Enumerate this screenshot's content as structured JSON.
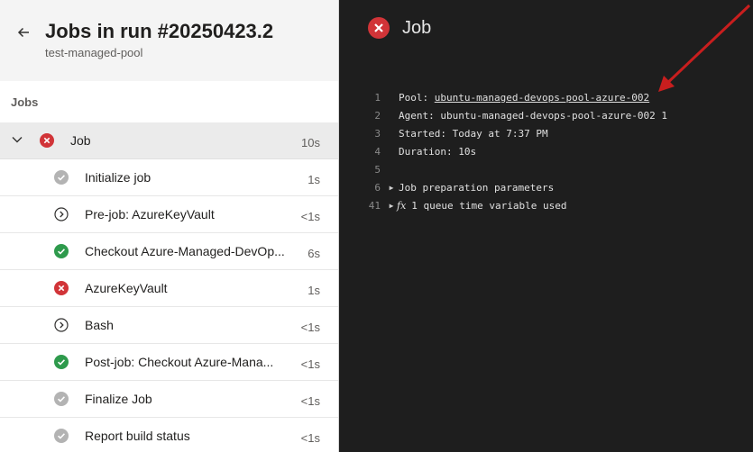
{
  "header": {
    "back_icon": "back-arrow-icon",
    "title": "Jobs in run #20250423.2",
    "subtitle": "test-managed-pool"
  },
  "jobs_section_label": "Jobs",
  "job": {
    "name": "Job",
    "duration": "10s",
    "status": "failed"
  },
  "steps": [
    {
      "name": "Initialize job",
      "duration": "1s",
      "status": "pending"
    },
    {
      "name": "Pre-job: AzureKeyVault",
      "duration": "<1s",
      "status": "skipped"
    },
    {
      "name": "Checkout Azure-Managed-DevOp...",
      "duration": "6s",
      "status": "succeeded"
    },
    {
      "name": "AzureKeyVault",
      "duration": "1s",
      "status": "failed"
    },
    {
      "name": "Bash",
      "duration": "<1s",
      "status": "skipped"
    },
    {
      "name": "Post-job: Checkout Azure-Mana...",
      "duration": "<1s",
      "status": "succeeded"
    },
    {
      "name": "Finalize Job",
      "duration": "<1s",
      "status": "pending"
    },
    {
      "name": "Report build status",
      "duration": "<1s",
      "status": "pending"
    }
  ],
  "log_panel": {
    "title": "Job",
    "status": "failed",
    "lines": [
      {
        "num": "1",
        "prefix": "Pool: ",
        "link": "ubuntu-managed-devops-pool-azure-002"
      },
      {
        "num": "2",
        "text": "Agent: ubuntu-managed-devops-pool-azure-002 1"
      },
      {
        "num": "3",
        "text": "Started: Today at 7:37 PM"
      },
      {
        "num": "4",
        "text": "Duration: 10s"
      },
      {
        "num": "5",
        "text": ""
      },
      {
        "num": "6",
        "text": "Job preparation parameters",
        "expandable": true
      },
      {
        "num": "41",
        "text": "1 queue time variable used",
        "expandable": true,
        "fx": "fx"
      }
    ]
  },
  "colors": {
    "failed": "#d13438",
    "succeeded": "#2e9a4c",
    "pending": "#b3b3b3",
    "annotation_arrow": "#c81e1e"
  }
}
